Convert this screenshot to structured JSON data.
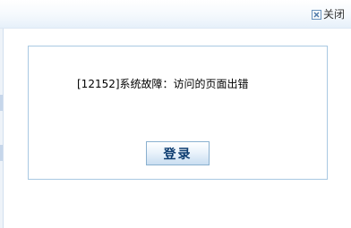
{
  "window": {
    "close_label": "关闭"
  },
  "dialog": {
    "message": "[12152]系统故障：访问的页面出错",
    "login_label": "登录"
  },
  "colors": {
    "dialog_border": "#a9c9e2",
    "button_text": "#0d3c70",
    "close_icon": "#6b93bd"
  },
  "icons": {
    "close": "close-x-icon"
  }
}
